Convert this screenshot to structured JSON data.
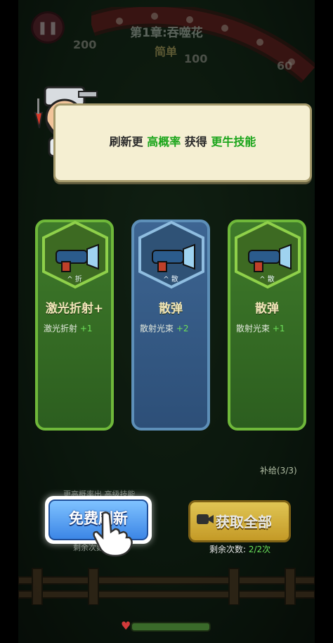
{
  "hud": {
    "pause_icon": "pause-icon",
    "chapter_title": "第1章:吞噬花",
    "difficulty": "简单",
    "bg_numbers": [
      "200",
      "100",
      "60"
    ]
  },
  "bubble": {
    "text_a": "刷新更",
    "text_b": "高概率",
    "text_c": "获得",
    "text_d": "更牛技能"
  },
  "cards": [
    {
      "tag": "^ 折",
      "name": "激光折射+",
      "desc": "激光折射",
      "plus": "+1"
    },
    {
      "tag": "^ 散",
      "name": "散弹",
      "desc": "散射光束",
      "plus": "+2"
    },
    {
      "tag": "^ 散",
      "name": "散弹",
      "desc": "散射光束",
      "plus": "+1"
    }
  ],
  "side": {
    "supply": "补给(3/3)"
  },
  "buttons": {
    "free_refresh": "免费刷新",
    "get_all": "获取全部",
    "hint_top": "更高概率出 高级技能",
    "remaining_left": "剩余次数",
    "remaining_right_label": "剩余次数: ",
    "remaining_right_count": "2/2次"
  },
  "colors": {
    "highlight": "#1aa51a",
    "card_green": "#6fb83a",
    "card_blue": "#5d8fb8",
    "button_blue": "#3c86e6",
    "button_gold": "#d9a92a"
  }
}
